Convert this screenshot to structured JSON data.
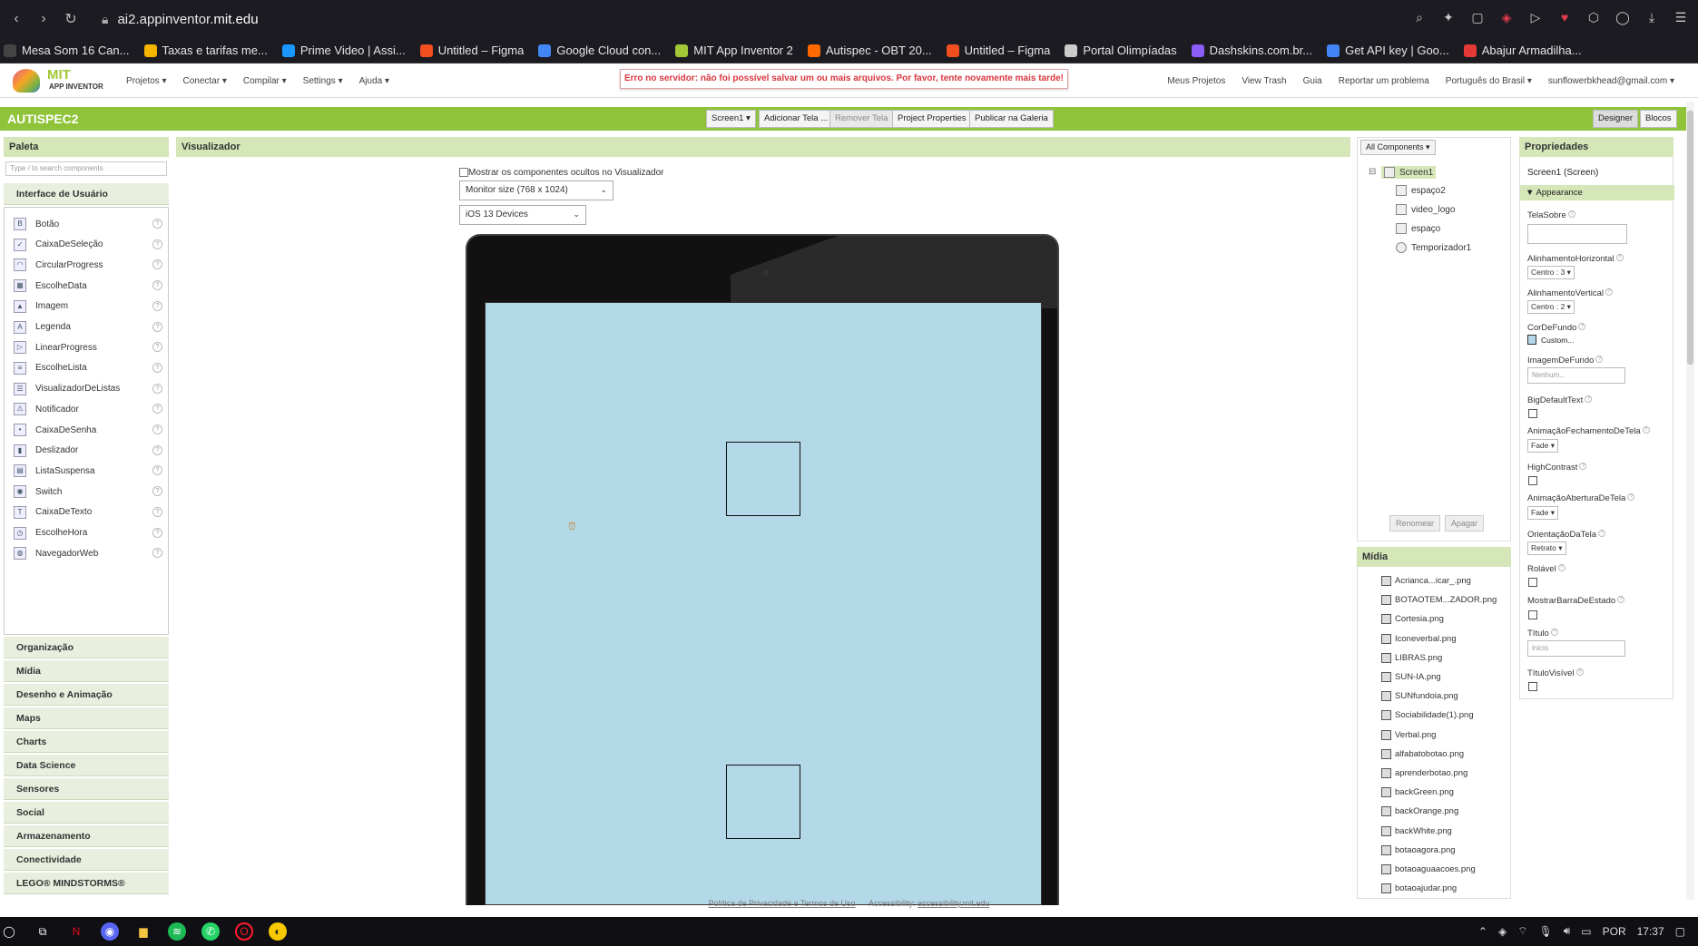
{
  "browser": {
    "url_host": "ai2.appinventor.",
    "url_domain": "mit.edu"
  },
  "bookmarks": [
    {
      "label": "Mesa Som 16 Can...",
      "color": "#444"
    },
    {
      "label": "Taxas e tarifas me...",
      "color": "#f5b400"
    },
    {
      "label": "Prime Video | Assi...",
      "color": "#1a98ff"
    },
    {
      "label": "Untitled – Figma",
      "color": "#f24e1e"
    },
    {
      "label": "Google Cloud con...",
      "color": "#4285f4"
    },
    {
      "label": "MIT App Inventor 2",
      "color": "#a2c736"
    },
    {
      "label": "Autispec - OBT 20...",
      "color": "#ff6a00"
    },
    {
      "label": "Untitled – Figma",
      "color": "#f24e1e"
    },
    {
      "label": "Portal Olimpíadas",
      "color": "#ccc"
    },
    {
      "label": "Dashskins.com.br...",
      "color": "#8b5cf6"
    },
    {
      "label": "Get API key | Goo...",
      "color": "#4285f4"
    },
    {
      "label": "Abajur Armadilha...",
      "color": "#e53935"
    }
  ],
  "header": {
    "logo_mit": "MIT",
    "logo_sub": "APP INVENTOR",
    "menu": [
      "Projetos ▾",
      "Conectar ▾",
      "Compilar ▾",
      "Settings ▾",
      "Ajuda ▾"
    ],
    "error": "Erro no servidor: não foi possível salvar um ou mais arquivos. Por favor, tente novamente mais tarde!",
    "right": [
      "Meus Projetos",
      "View Trash",
      "Guia",
      "Reportar um problema",
      "Português do Brasil ▾",
      "sunflowerbkhead@gmail.com ▾"
    ]
  },
  "project": {
    "title": "AUTISPEC2",
    "screen_btn": "Screen1 ▾",
    "add_screen": "Adicionar Tela ...",
    "remove_screen": "Remover Tela",
    "props_btn": "Project Properties",
    "publish": "Publicar na Galeria",
    "designer": "Designer",
    "blocks": "Blocos"
  },
  "palette": {
    "title": "Paleta",
    "search_placeholder": "Type / to search components",
    "ui_category": "Interface de Usuário",
    "components": [
      {
        "label": "Botão",
        "icon": "B"
      },
      {
        "label": "CaixaDeSeleção",
        "icon": "✓"
      },
      {
        "label": "CircularProgress",
        "icon": "◠"
      },
      {
        "label": "EscolheData",
        "icon": "▦"
      },
      {
        "label": "Imagem",
        "icon": "▲"
      },
      {
        "label": "Legenda",
        "icon": "A"
      },
      {
        "label": "LinearProgress",
        "icon": "▷"
      },
      {
        "label": "EscolheLista",
        "icon": "≡"
      },
      {
        "label": "VisualizadorDeListas",
        "icon": "☰"
      },
      {
        "label": "Notificador",
        "icon": "⚠"
      },
      {
        "label": "CaixaDeSenha",
        "icon": "•"
      },
      {
        "label": "Deslizador",
        "icon": "▮"
      },
      {
        "label": "ListaSuspensa",
        "icon": "▤"
      },
      {
        "label": "Switch",
        "icon": "◉"
      },
      {
        "label": "CaixaDeTexto",
        "icon": "T"
      },
      {
        "label": "EscolheHora",
        "icon": "◷"
      },
      {
        "label": "NavegadorWeb",
        "icon": "◍"
      }
    ],
    "help": "?",
    "categories": [
      "Organização",
      "Mídia",
      "Desenho e Animação",
      "Maps",
      "Charts",
      "Data Science",
      "Sensores",
      "Social",
      "Armazenamento",
      "Conectividade",
      "LEGO® MINDSTORMS®"
    ]
  },
  "viewer": {
    "title": "Visualizador",
    "hidden_label": "Mostrar os componentes ocultos no Visualizador",
    "size_select": "Monitor size (768 x 1024)",
    "device_select": "iOS 13 Devices",
    "clock_icon": "clock-icon"
  },
  "tree": {
    "filter": "All Components ▾",
    "collapse": "⊟",
    "items": [
      "Screen1",
      "espaço2",
      "video_logo",
      "espaço",
      "Temporizador1"
    ],
    "rename": "Renomear",
    "delete": "Apagar"
  },
  "media": {
    "title": "Mídia",
    "files": [
      "Acrianca...icar_.png",
      "BOTAOTEM...ZADOR.png",
      "Cortesia.png",
      "Iconeverbal.png",
      "LIBRAS.png",
      "SUN-IA.png",
      "SUNfundoia.png",
      "Sociabilidade(1).png",
      "Verbal.png",
      "alfabatobotao.png",
      "aprenderbotao.png",
      "backGreen.png",
      "backOrange.png",
      "backWhite.png",
      "botaoagora.png",
      "botaoaguaacoes.png",
      "botaoajudar.png"
    ]
  },
  "properties": {
    "title": "Propriedades",
    "subtitle": "Screen1 (Screen)",
    "section": "▼ Appearance",
    "telasobre": "TelaSobre",
    "alinh_h": "AlinhamentoHorizontal",
    "alinh_h_val": "Centro : 3 ▾",
    "alinh_v": "AlinhamentoVertical",
    "alinh_v_val": "Centro : 2 ▾",
    "cor": "CorDeFundo",
    "cor_val": "Custom...",
    "imagem": "ImagemDeFundo",
    "imagem_val": "Nenhum...",
    "big": "BigDefaultText",
    "anim_fech": "AnimaçãoFechamentoDeTela",
    "anim_fech_val": "Fade ▾",
    "contrast": "HighContrast",
    "anim_abert": "AnimaçãoAberturaDeTela",
    "anim_abert_val": "Fade ▾",
    "orient": "OrientaçãoDaTela",
    "orient_val": "Retrato ▾",
    "rolavel": "Rolável",
    "barra": "MostrarBarraDeEstado",
    "titulo": "Título",
    "titulo_val": "inicio",
    "titulo_vis": "TítuloVisível",
    "help": "?"
  },
  "footer": {
    "privacy": "Política de Privacidade e Termos de Uso",
    "acc_label": "Accessibility:",
    "acc_link": "accessibility.mit.edu"
  },
  "taskbar": {
    "lang": "POR",
    "time": "17:37"
  }
}
